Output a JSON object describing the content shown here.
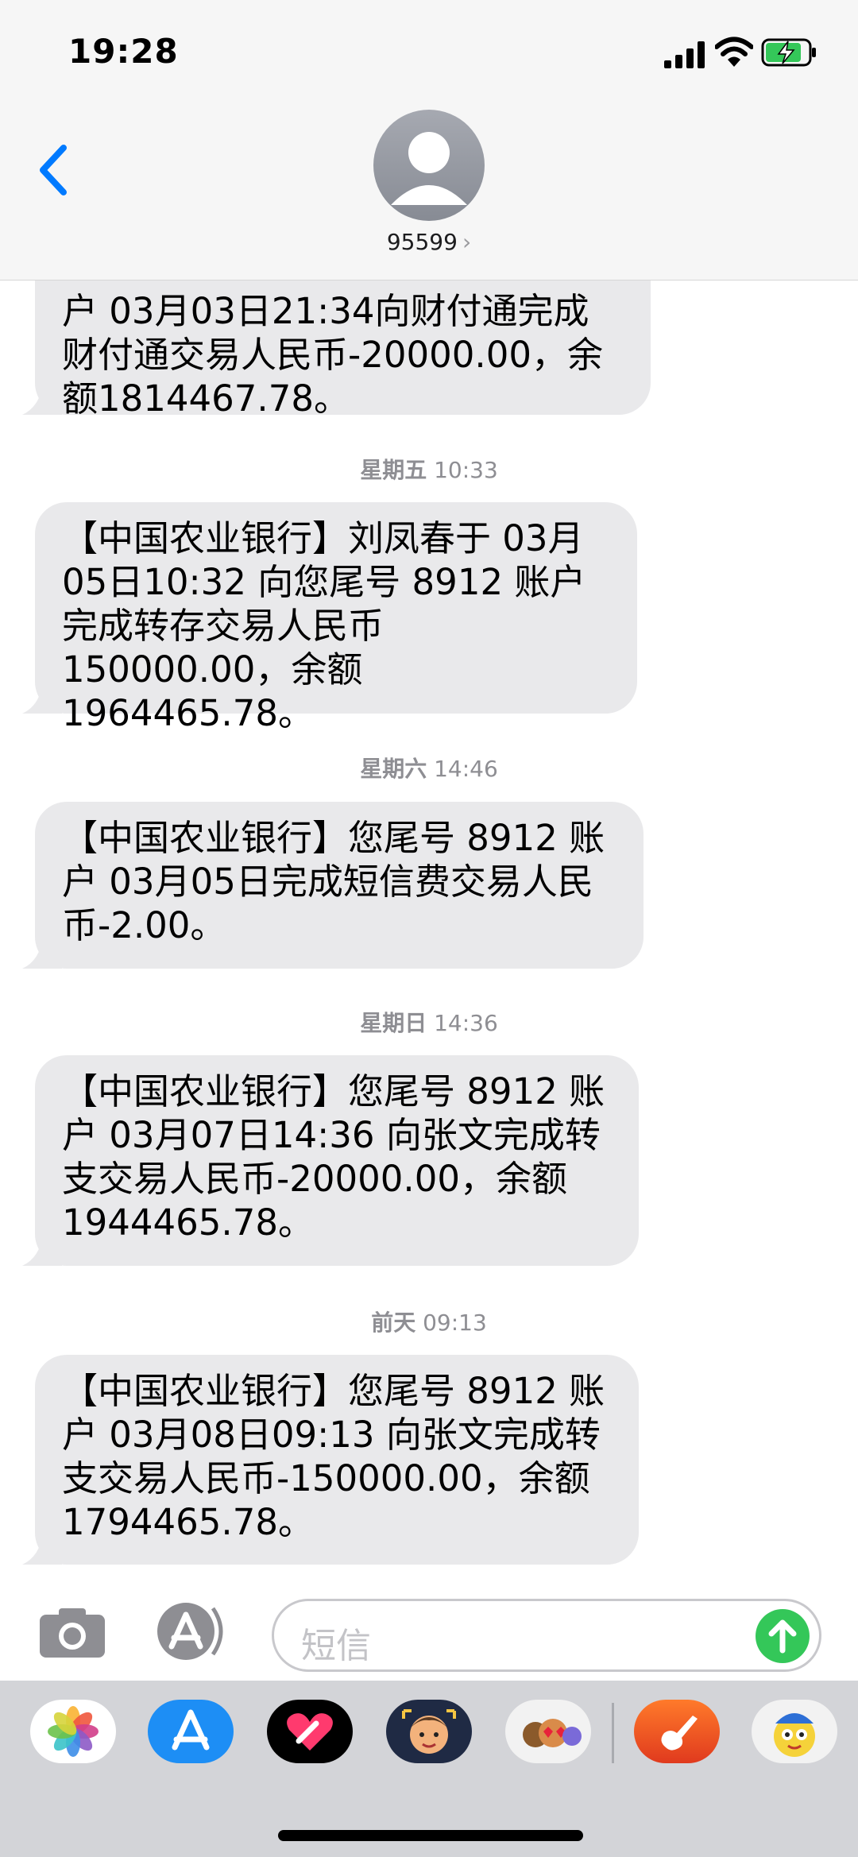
{
  "status_bar": {
    "time": "19:28"
  },
  "header": {
    "contact": "95599",
    "chevron": "›"
  },
  "messages": [
    {
      "text": "户 03月03日21:34向财付通完成财付通交易人民币-20000.00，余额1814467.78。"
    },
    {
      "day": "星期五",
      "time": "10:33",
      "text": "【中国农业银行】刘凤春于 03月05日10:32 向您尾号 8912 账户完成转存交易人民币 150000.00，余额 1964465.78。"
    },
    {
      "day": "星期六",
      "time": "14:46",
      "text": "【中国农业银行】您尾号 8912 账户 03月05日完成短信费交易人民币-2.00。"
    },
    {
      "day": "星期日",
      "time": "14:36",
      "text": "【中国农业银行】您尾号 8912 账户 03月07日14:36 向张文完成转支交易人民币-20000.00，余额 1944465.78。"
    },
    {
      "day": "前天",
      "time": "09:13",
      "text": "【中国农业银行】您尾号 8912 账户 03月08日09:13 向张文完成转支交易人民币-150000.00，余额 1794465.78。"
    }
  ],
  "compose": {
    "placeholder": "短信"
  },
  "colors": {
    "accent": "#007aff",
    "bubble": "#e9e9eb",
    "send": "#34c759"
  },
  "app_strip": [
    "photos-icon",
    "app-store-icon",
    "digital-touch-icon",
    "memoji-icon",
    "animoji-icon",
    "garageband-icon",
    "sticker-app-icon"
  ]
}
